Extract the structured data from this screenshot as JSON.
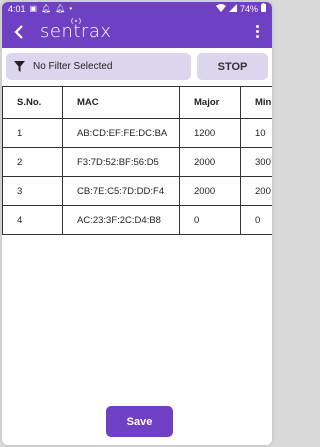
{
  "status_bar": {
    "time": "4:01",
    "battery": "74%"
  },
  "app_bar": {
    "logo_text": "sentrax",
    "accent_color": "#6f3fc4"
  },
  "filter": {
    "label": "No Filter Selected",
    "icon": "filter-icon"
  },
  "actions": {
    "stop_label": "STOP",
    "save_label": "Save"
  },
  "table": {
    "headers": [
      "S.No.",
      "MAC",
      "Major",
      "Min"
    ],
    "rows": [
      [
        "1",
        "AB:CD:EF:FE:DC:BA",
        "1200",
        "10"
      ],
      [
        "2",
        "F3:7D:52:BF:56:D5",
        "2000",
        "300"
      ],
      [
        "3",
        "CB:7E:C5:7D:DD:F4",
        "2000",
        "200"
      ],
      [
        "4",
        "AC:23:3F:2C:D4:B8",
        "0",
        "0"
      ]
    ]
  }
}
